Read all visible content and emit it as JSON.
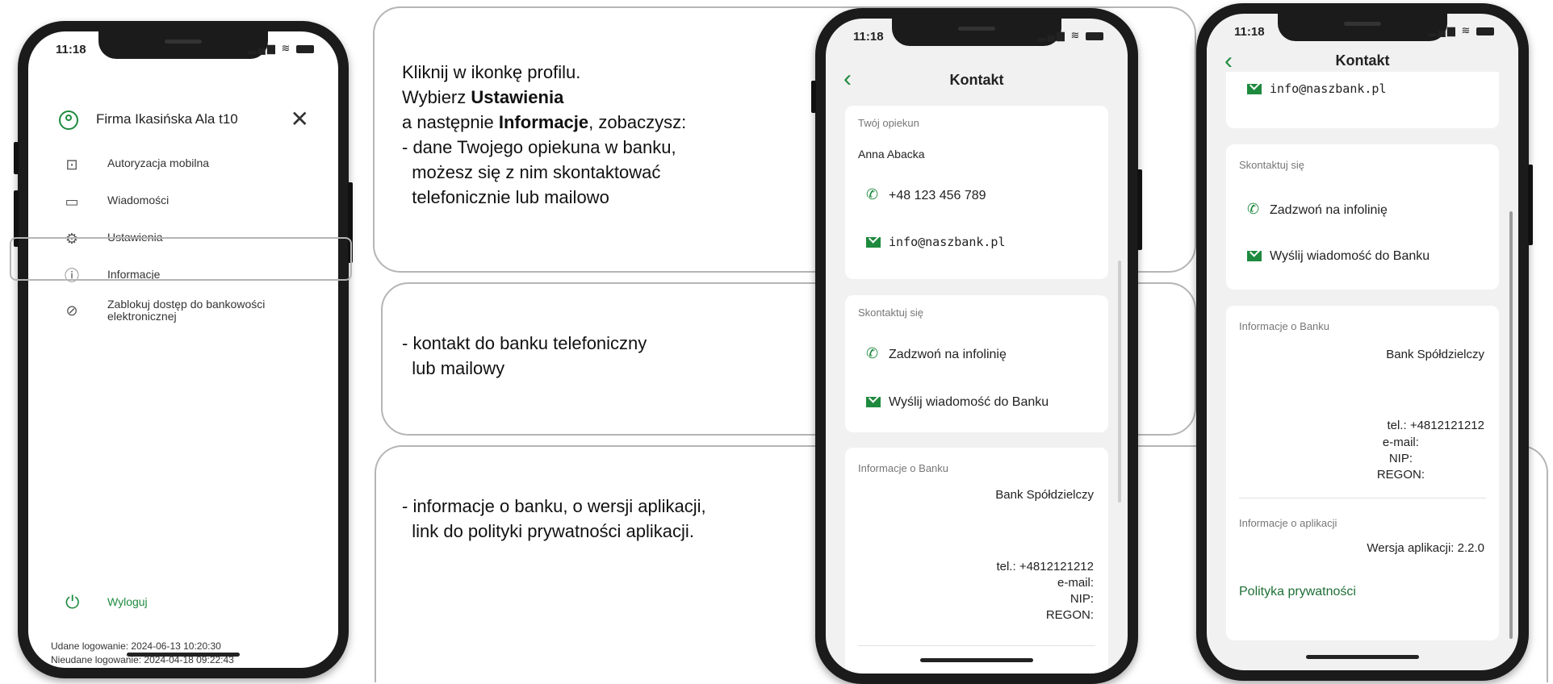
{
  "status_time": "11:18",
  "menu": {
    "company_name": "Firma Ikasińska Ala t10",
    "items": [
      {
        "label": "Autoryzacja mobilna"
      },
      {
        "label": "Wiadomości"
      },
      {
        "label": "Ustawienia"
      },
      {
        "label": "Informacje"
      },
      {
        "label": "Zablokuj dostęp do bankowości\nelektronicznej"
      }
    ],
    "logout_label": "Wyloguj",
    "login_success": "Udane logowanie: 2024-06-13 10:20:30",
    "login_failed": "Nieudane logowanie: 2024-04-18 09:22:43"
  },
  "instructions": {
    "block1_line1": "Kliknij w ikonkę profilu.",
    "block1_line2_prefix": "Wybierz ",
    "block1_line2_bold": "Ustawienia",
    "block1_line3_prefix": "a następnie ",
    "block1_line3_bold": "Informacje",
    "block1_line3_suffix": ", zobaczysz:",
    "block1_rest": "- dane Twojego opiekuna w banku,\n  możesz się z nim skontaktować\n  telefonicznie lub mailowo",
    "block2": "- kontakt do banku telefoniczny\n  lub mailowy",
    "block3": "- informacje o banku, o wersji aplikacji,\n  link do polityki prywatności aplikacji."
  },
  "kontakt": {
    "title": "Kontakt",
    "advisor_section": "Twój opiekun",
    "advisor_name": "Anna Abacka",
    "advisor_phone": "+48 123 456 789",
    "advisor_email": "info@naszbank.pl",
    "contact_section": "Skontaktuj się",
    "call_label": "Zadzwoń na infolinię",
    "message_label": "Wyślij wiadomość do Banku",
    "bank_section": "Informacje o Banku",
    "bank_name": "Bank Spółdzielczy",
    "bank_tel": "tel.: +4812121212",
    "bank_email": "e-mail:",
    "bank_nip": "NIP:",
    "bank_regon": "REGON:",
    "app_section": "Informacje o aplikacji",
    "app_version": "Wersja aplikacji: 2.2.0",
    "privacy_link": "Polityka prywatności"
  }
}
